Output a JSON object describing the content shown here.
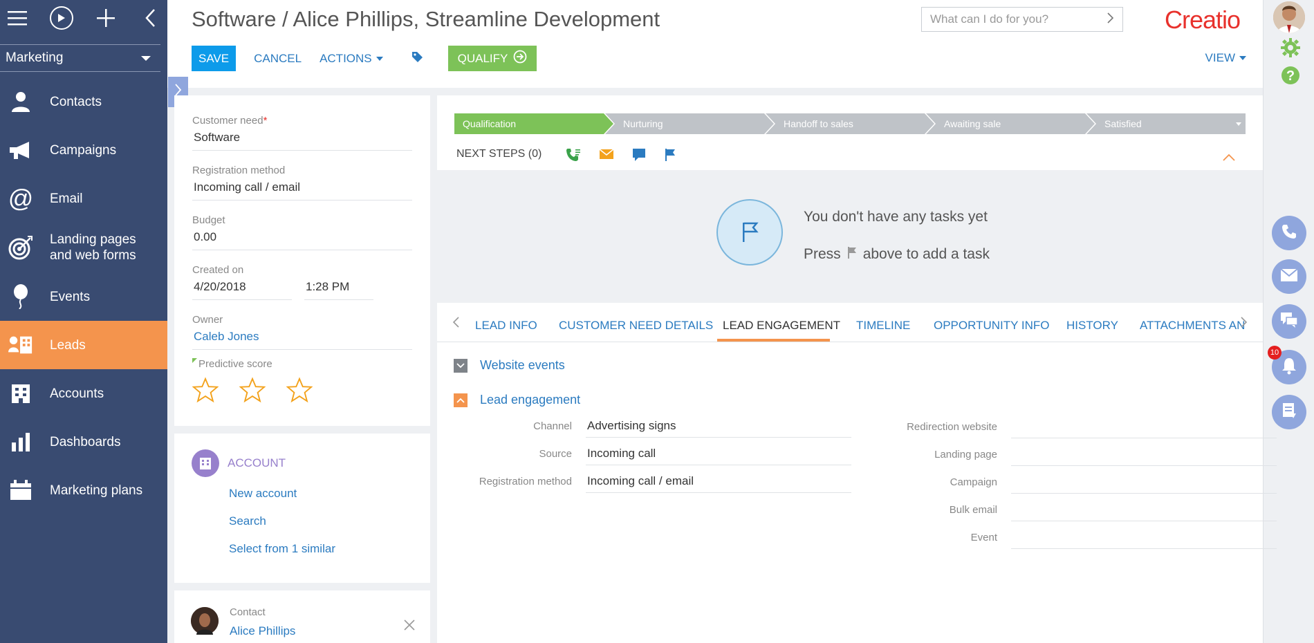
{
  "sidebar": {
    "workspace": "Marketing",
    "items": [
      {
        "label": "Contacts",
        "icon": "contact-icon"
      },
      {
        "label": "Campaigns",
        "icon": "megaphone-icon"
      },
      {
        "label": "Email",
        "icon": "at-icon"
      },
      {
        "label": "Landing pages and web forms",
        "line1": "Landing pages",
        "line2": "and web forms",
        "icon": "target-icon"
      },
      {
        "label": "Events",
        "icon": "balloon-icon"
      },
      {
        "label": "Leads",
        "icon": "leads-icon",
        "active": true
      },
      {
        "label": "Accounts",
        "icon": "building-icon"
      },
      {
        "label": "Dashboards",
        "icon": "bar-chart-icon"
      },
      {
        "label": "Marketing plans",
        "icon": "calendar-icon"
      }
    ]
  },
  "header": {
    "title": "Software / Alice Phillips, Streamline Development",
    "search_placeholder": "What can I do for you?",
    "logo": "Creatio",
    "toolbar": {
      "save": "SAVE",
      "cancel": "CANCEL",
      "actions": "ACTIONS",
      "qualify": "QUALIFY",
      "view": "VIEW"
    }
  },
  "profile": {
    "customer_need_label": "Customer need",
    "customer_need_value": "Software",
    "registration_method_label": "Registration method",
    "registration_method_value": "Incoming call / email",
    "budget_label": "Budget",
    "budget_value": "0.00",
    "created_on_label": "Created on",
    "created_on_date": "4/20/2018",
    "created_on_time": "1:28 PM",
    "owner_label": "Owner",
    "owner_value": "Caleb Jones",
    "predictive_score_label": "Predictive score",
    "stars": 0
  },
  "account": {
    "title": "ACCOUNT",
    "links": [
      "New account",
      "Search",
      "Select from 1 similar"
    ]
  },
  "contact": {
    "label": "Contact",
    "name": "Alice Phillips"
  },
  "stages": [
    "Qualification",
    "Nurturing",
    "Handoff to sales",
    "Awaiting sale",
    "Satisfied"
  ],
  "next_steps": {
    "label": "NEXT STEPS (0)",
    "empty_line1": "You don't have any tasks yet",
    "empty_line2_before": "Press",
    "empty_line2_after": "above to add a task"
  },
  "tabs": [
    "LEAD INFO",
    "CUSTOMER NEED DETAILS",
    "LEAD ENGAGEMENT",
    "TIMELINE",
    "OPPORTUNITY INFO",
    "HISTORY",
    "ATTACHMENTS AN"
  ],
  "active_tab": "LEAD ENGAGEMENT",
  "groups": {
    "website_events": "Website events",
    "lead_engagement": "Lead engagement"
  },
  "engagement_left": [
    {
      "label": "Channel",
      "value": "Advertising signs"
    },
    {
      "label": "Source",
      "value": "Incoming call"
    },
    {
      "label": "Registration method",
      "value": "Incoming call / email"
    }
  ],
  "engagement_right": [
    {
      "label": "Redirection website",
      "value": ""
    },
    {
      "label": "Landing page",
      "value": ""
    },
    {
      "label": "Campaign",
      "value": ""
    },
    {
      "label": "Bulk email",
      "value": ""
    },
    {
      "label": "Event",
      "value": ""
    }
  ],
  "notifications_count": "10",
  "colors": {
    "sidebar": "#394b71",
    "active": "#f4944d",
    "primary": "#0d9bea",
    "success": "#7dc258",
    "link": "#2b7bc0",
    "brand": "#e8312c"
  }
}
